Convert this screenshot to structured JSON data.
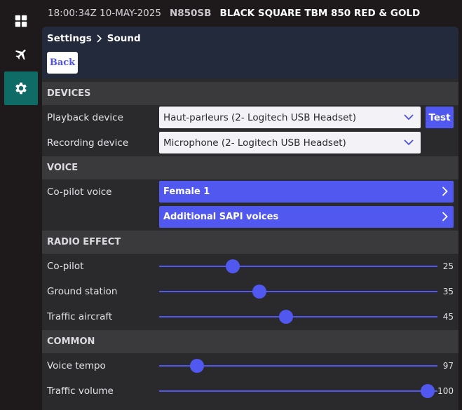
{
  "nav": {
    "items": [
      {
        "icon": "grid-icon",
        "active": false
      },
      {
        "icon": "airplane-icon",
        "active": false
      },
      {
        "icon": "gear-icon",
        "active": true
      }
    ]
  },
  "topbar": {
    "time": "18:00:34Z 10-MAY-2025",
    "tail": "N850SB",
    "aircraft": "BLACK SQUARE TBM 850 RED & GOLD"
  },
  "breadcrumb": {
    "parent": "Settings",
    "current": "Sound"
  },
  "back_label": "Back",
  "sections": {
    "devices": "DEVICES",
    "voice": "VOICE",
    "radio": "RADIO EFFECT",
    "common": "COMMON"
  },
  "devices": {
    "playback": {
      "label": "Playback device",
      "value": "Haut-parleurs (2- Logitech USB Headset)"
    },
    "recording": {
      "label": "Recording device",
      "value": "Microphone (2- Logitech USB Headset)"
    },
    "test_label": "Test"
  },
  "voice": {
    "copilot_label": "Co-pilot voice",
    "copilot_value": "Female 1",
    "sapi_label": "Additional SAPI voices"
  },
  "radio": {
    "copilot": {
      "label": "Co-pilot",
      "value": "25",
      "fraction": 0.265
    },
    "ground": {
      "label": "Ground station",
      "value": "35",
      "fraction": 0.36
    },
    "traffic": {
      "label": "Traffic aircraft",
      "value": "45",
      "fraction": 0.455
    }
  },
  "common": {
    "tempo": {
      "label": "Voice tempo",
      "value": "97",
      "fraction": 0.135
    },
    "volume": {
      "label": "Traffic volume",
      "value": "100",
      "fraction": 0.965
    }
  },
  "colors": {
    "accent": "#5158f0",
    "active_nav": "#0f6b66",
    "section_bg": "#3a393c",
    "header_bg": "#232a3c"
  }
}
